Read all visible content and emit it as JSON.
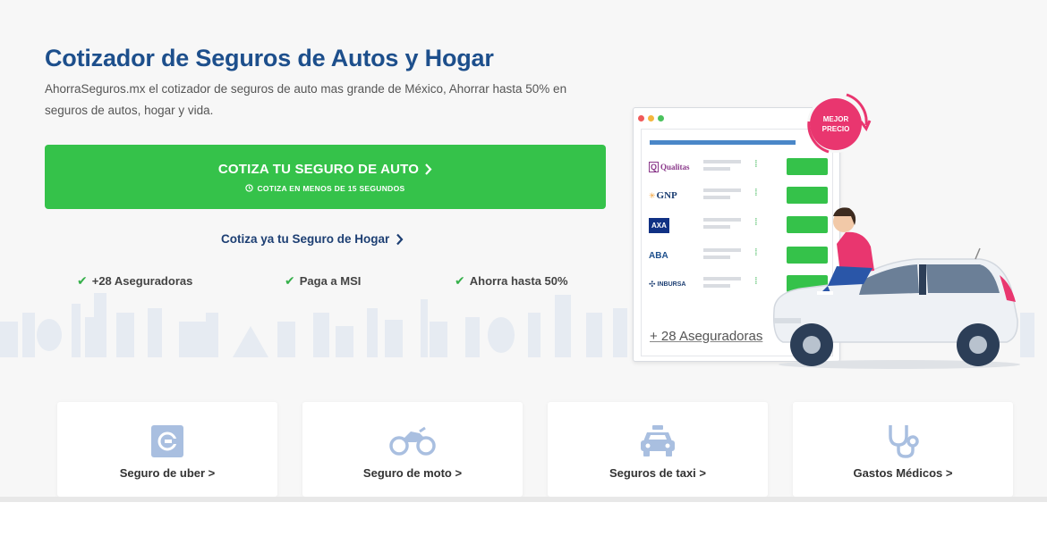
{
  "hero": {
    "title": "Cotizador de Seguros de Autos y Hogar",
    "subtitle": "AhorraSeguros.mx el cotizador de seguros de auto mas grande de México, Ahorrar hasta 50% en seguros de autos, hogar y vida.",
    "cta_main": "COTIZA TU SEGURO DE AUTO",
    "cta_sub": "COTIZA EN MENOS DE 15 SEGUNDOS",
    "home_link": "Cotiza ya tu Seguro de Hogar",
    "features": [
      "+28 Aseguradoras",
      "Paga a MSI",
      "Ahorra hasta 50%"
    ]
  },
  "illustration": {
    "badge_line1": "MEJOR",
    "badge_line2": "PRECIO",
    "insurers": [
      {
        "logo": "Qualitas",
        "icon": "qualitas-logo"
      },
      {
        "logo": "GNP",
        "icon": "gnp-logo"
      },
      {
        "logo": "AXA",
        "icon": "axa-logo"
      },
      {
        "logo": "ABA",
        "icon": "aba-logo"
      },
      {
        "logo": "INBURSA",
        "icon": "inbursa-logo"
      }
    ],
    "more": "+ 28 Aseguradoras"
  },
  "cards": [
    {
      "label": "Seguro de uber >",
      "icon": "uber-icon"
    },
    {
      "label": "Seguro de moto >",
      "icon": "motorcycle-icon"
    },
    {
      "label": "Seguros de taxi >",
      "icon": "taxi-icon"
    },
    {
      "label": "Gastos Médicos >",
      "icon": "stethoscope-icon"
    }
  ],
  "colors": {
    "primary_blue": "#1d4f8c",
    "green": "#35c24a",
    "pink": "#e9366f",
    "icon_blue": "#a9bfe0"
  }
}
